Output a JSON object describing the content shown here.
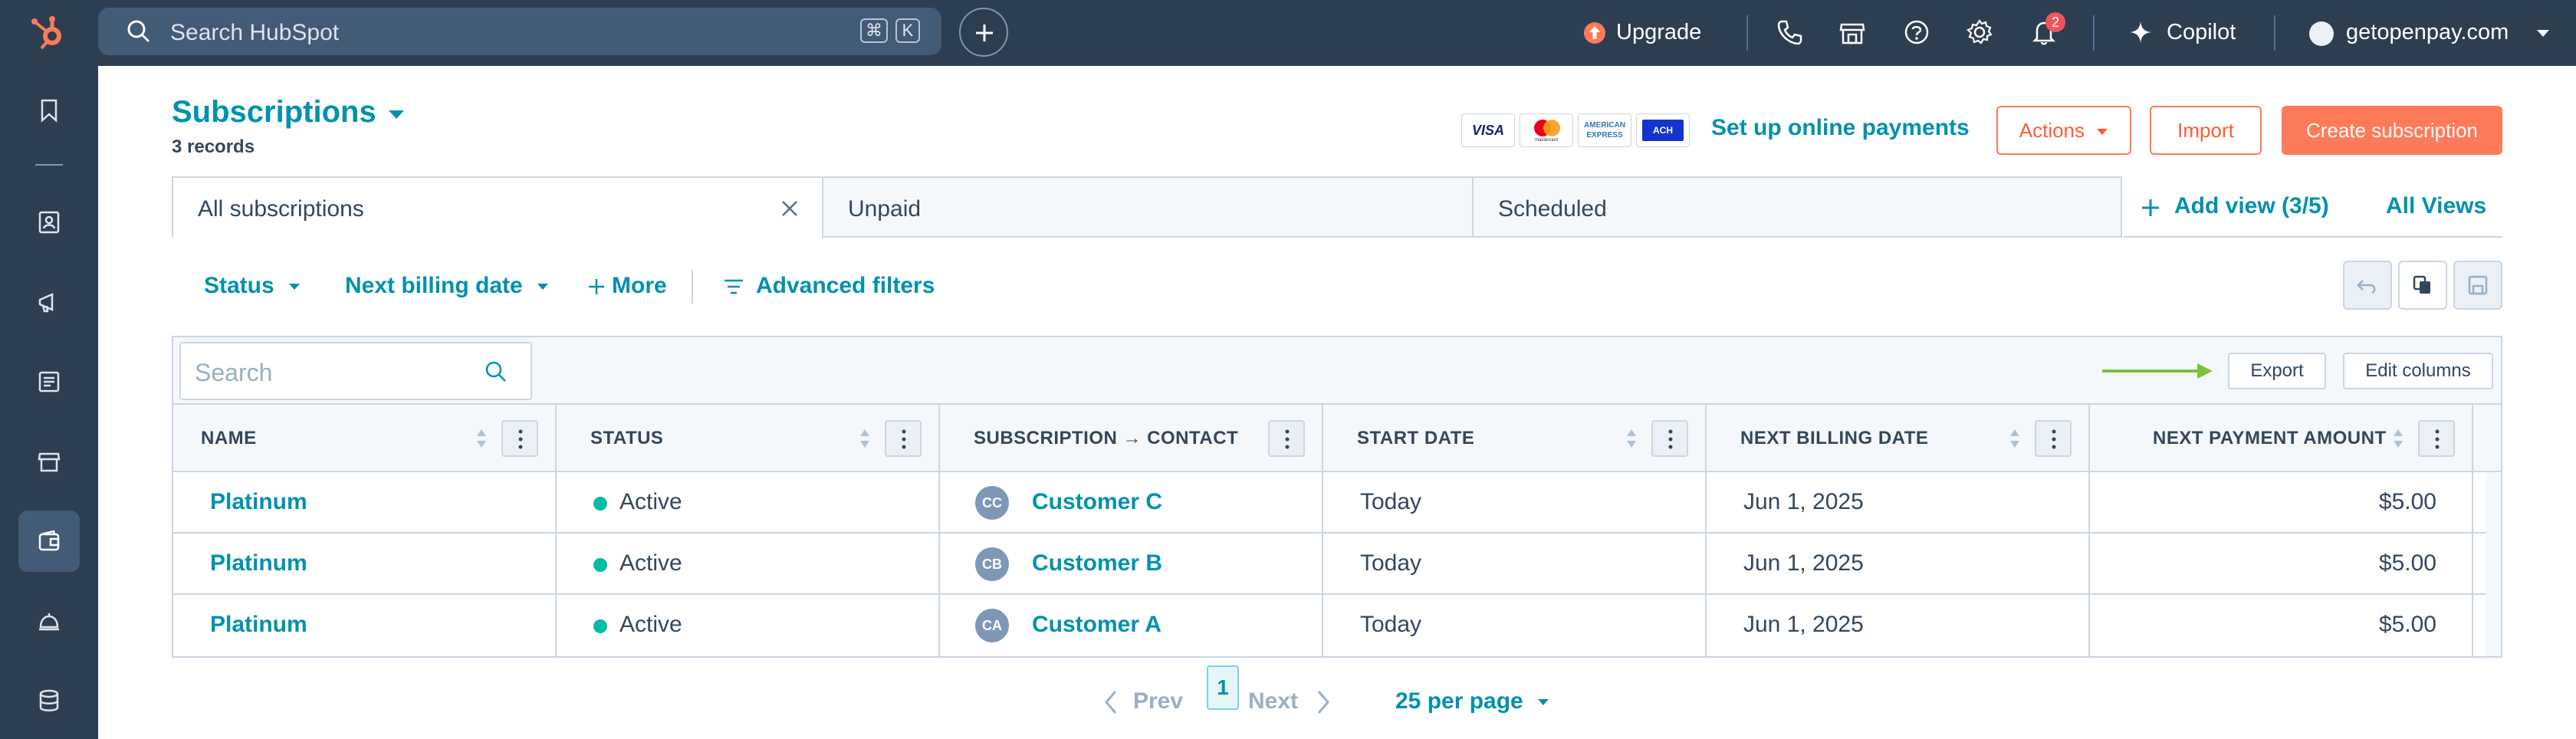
{
  "topbar": {
    "search_placeholder": "Search HubSpot",
    "shortcut_cmd": "⌘",
    "shortcut_key": "K",
    "upgrade_label": "Upgrade",
    "notification_count": "2",
    "copilot_label": "Copilot",
    "account_name": "getopenpay.com"
  },
  "header": {
    "title": "Subscriptions",
    "record_count": "3 records",
    "payment_cards": [
      "VISA",
      "mastercard",
      "AMERICAN EXPRESS",
      "ACH"
    ],
    "setup_payments_label": "Set up online payments",
    "actions_label": "Actions",
    "import_label": "Import",
    "create_label": "Create subscription"
  },
  "views": {
    "tabs": [
      {
        "label": "All subscriptions",
        "active": true
      },
      {
        "label": "Unpaid",
        "active": false
      },
      {
        "label": "Scheduled",
        "active": false
      }
    ],
    "add_view_label": "Add view (3/5)",
    "all_views_label": "All Views"
  },
  "filters": {
    "status_label": "Status",
    "billing_label": "Next billing date",
    "more_label": "More",
    "advanced_label": "Advanced filters"
  },
  "table": {
    "search_placeholder": "Search",
    "export_label": "Export",
    "edit_columns_label": "Edit columns",
    "columns": [
      "NAME",
      "STATUS",
      "SUBSCRIPTION → CONTACT",
      "START DATE",
      "NEXT BILLING DATE",
      "NEXT PAYMENT AMOUNT"
    ],
    "rows": [
      {
        "name": "Platinum",
        "status": "Active",
        "initials": "CC",
        "contact": "Customer C",
        "start": "Today",
        "billing": "Jun 1, 2025",
        "amount": "$5.00"
      },
      {
        "name": "Platinum",
        "status": "Active",
        "initials": "CB",
        "contact": "Customer B",
        "start": "Today",
        "billing": "Jun 1, 2025",
        "amount": "$5.00"
      },
      {
        "name": "Platinum",
        "status": "Active",
        "initials": "CA",
        "contact": "Customer A",
        "start": "Today",
        "billing": "Jun 1, 2025",
        "amount": "$5.00"
      }
    ]
  },
  "pagination": {
    "prev_label": "Prev",
    "current_page": "1",
    "next_label": "Next",
    "per_page_label": "25 per page"
  },
  "colors": {
    "nav_bg": "#2d3e50",
    "link": "#0091ae",
    "accent": "#ff7a59",
    "active_status": "#00bda5",
    "arrow": "#7fbf3f"
  }
}
